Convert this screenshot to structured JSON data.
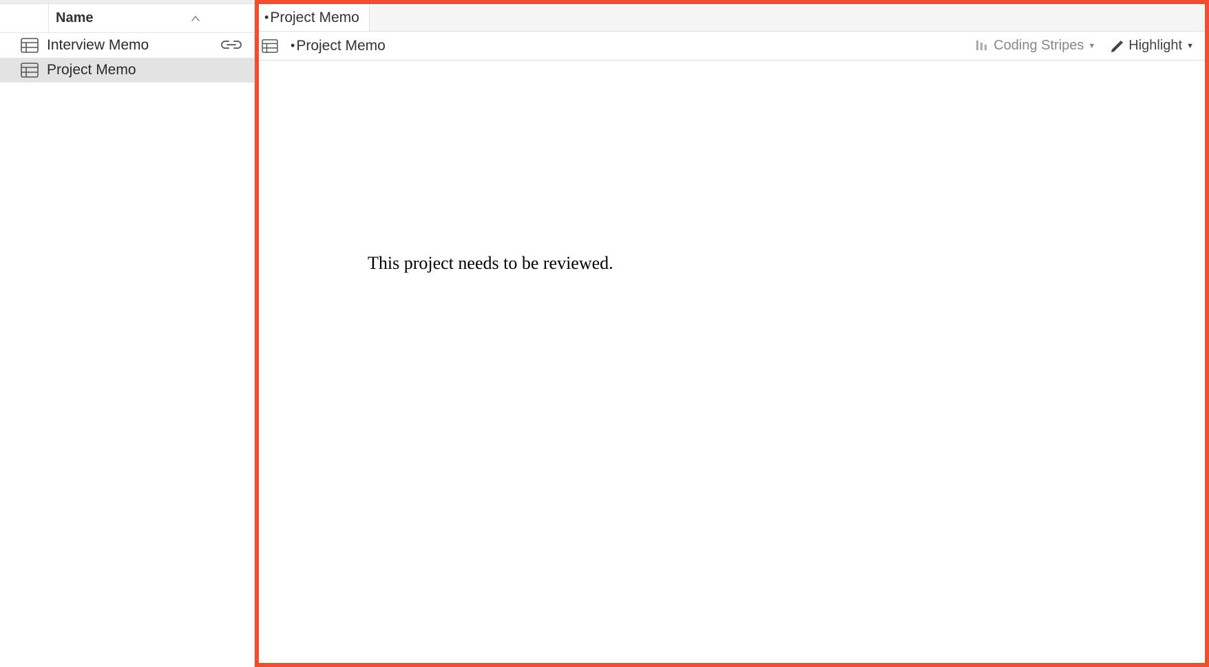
{
  "sidebar": {
    "header": {
      "label": "Name"
    },
    "items": [
      {
        "label": "Interview Memo",
        "hasLink": true,
        "selected": false
      },
      {
        "label": "Project Memo",
        "hasLink": false,
        "selected": true
      }
    ]
  },
  "main": {
    "tabs": [
      {
        "prefix": "•",
        "label": "Project Memo"
      }
    ],
    "toolbar": {
      "titlePrefix": "•",
      "title": "Project Memo",
      "codingStripesLabel": "Coding Stripes",
      "highlightLabel": "Highlight"
    },
    "document": {
      "body": "This project needs to be reviewed."
    }
  }
}
